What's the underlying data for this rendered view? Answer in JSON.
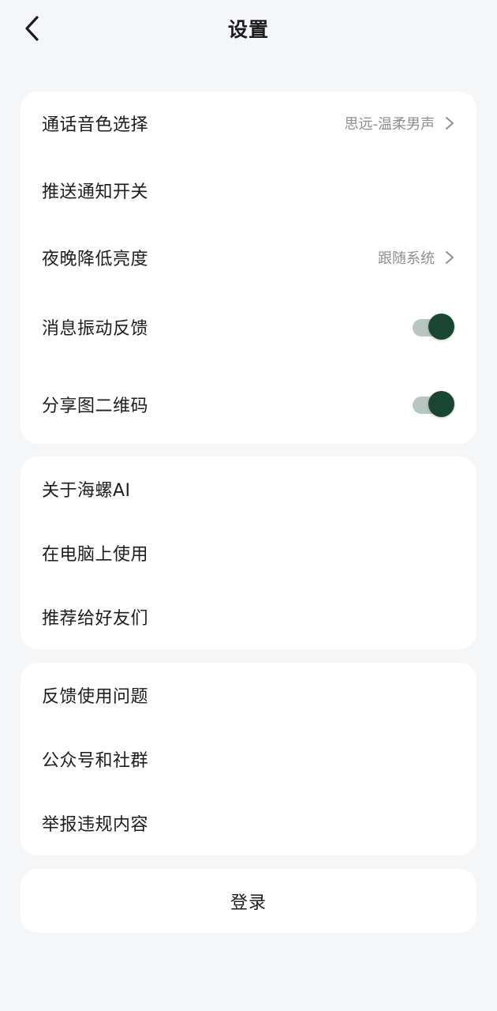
{
  "header": {
    "title": "设置"
  },
  "group1": {
    "voice": {
      "label": "通话音色选择",
      "value": "思远-温柔男声"
    },
    "push": {
      "label": "推送通知开关"
    },
    "night": {
      "label": "夜晚降低亮度",
      "value": "跟随系统"
    },
    "vibrate": {
      "label": "消息振动反馈",
      "on": true
    },
    "share_qr": {
      "label": "分享图二维码",
      "on": true
    }
  },
  "group2": {
    "about": {
      "label": "关于海螺AI"
    },
    "desktop": {
      "label": "在电脑上使用"
    },
    "recommend": {
      "label": "推荐给好友们"
    }
  },
  "group3": {
    "feedback": {
      "label": "反馈使用问题"
    },
    "community": {
      "label": "公众号和社群"
    },
    "report": {
      "label": "举报违规内容"
    }
  },
  "login": {
    "label": "登录"
  },
  "colors": {
    "toggle_on": "#1a4533",
    "toggle_track": "#b7c6bf",
    "background": "#f5f6f8"
  }
}
